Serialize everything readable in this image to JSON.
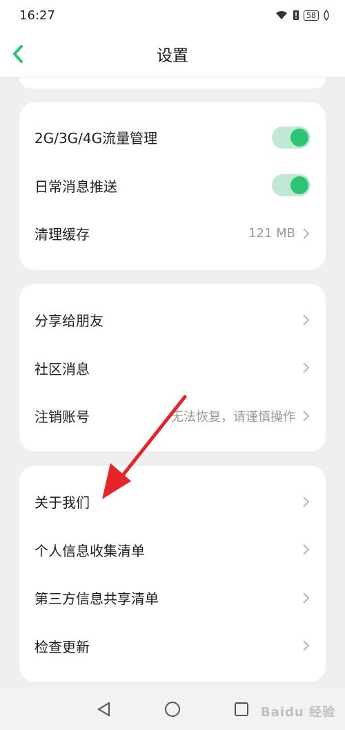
{
  "status": {
    "time": "16:27",
    "battery": "58"
  },
  "header": {
    "title": "设置"
  },
  "sections": [
    {
      "rows": [
        {
          "label": "2G/3G/4G流量管理",
          "type": "toggle",
          "on": true
        },
        {
          "label": "日常消息推送",
          "type": "toggle",
          "on": true
        },
        {
          "label": "清理缓存",
          "type": "link",
          "value": "121 MB"
        }
      ]
    },
    {
      "rows": [
        {
          "label": "分享给朋友",
          "type": "link",
          "value": ""
        },
        {
          "label": "社区消息",
          "type": "link",
          "value": ""
        },
        {
          "label": "注销账号",
          "type": "link",
          "value": "无法恢复，请谨慎操作"
        }
      ]
    },
    {
      "rows": [
        {
          "label": "关于我们",
          "type": "link",
          "value": ""
        },
        {
          "label": "个人信息收集清单",
          "type": "link",
          "value": ""
        },
        {
          "label": "第三方信息共享清单",
          "type": "link",
          "value": ""
        },
        {
          "label": "检查更新",
          "type": "link",
          "value": ""
        }
      ]
    }
  ],
  "colors": {
    "accent": "#2ec476",
    "toggle_track": "#bfe9d2",
    "annotation_arrow": "#e8232a"
  },
  "watermark": "Baidu 经验"
}
